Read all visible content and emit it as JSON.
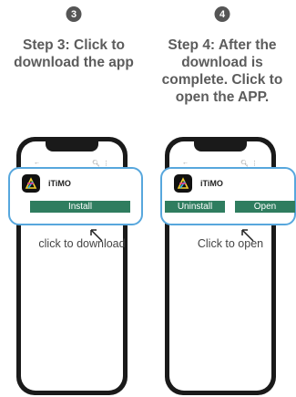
{
  "steps": [
    {
      "number": "3",
      "title": "Step 3: Click to download the app",
      "app_name": "iTiMO",
      "install_label": "Install",
      "caption": "click to download"
    },
    {
      "number": "4",
      "title": "Step 4: After the download is complete. Click to open the APP.",
      "app_name": "iTiMO",
      "uninstall_label": "Uninstall",
      "open_label": "Open",
      "caption": "Click to open"
    }
  ],
  "colors": {
    "accent_button": "#2f7d5f",
    "card_border": "#57a7dd",
    "step_badge": "#555555"
  },
  "icons": {
    "back": "back-arrow-icon",
    "search": "search-icon",
    "more": "more-vertical-icon",
    "app": "itimo-logo-icon",
    "pointer": "pointer-arrow-icon"
  }
}
